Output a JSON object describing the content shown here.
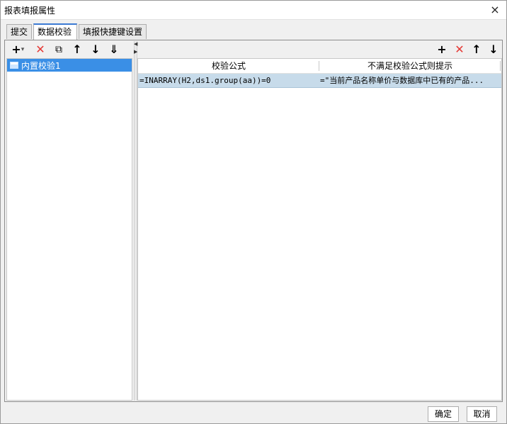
{
  "window": {
    "title": "报表填报属性",
    "close_icon": "×"
  },
  "tabs": [
    {
      "label": "提交",
      "active": false
    },
    {
      "label": "数据校验",
      "active": true
    },
    {
      "label": "填报快捷键设置",
      "active": false
    }
  ],
  "left_toolbar": {
    "add": "+",
    "add_dropdown": "▾",
    "delete": "✕",
    "copy": "⧉",
    "move_up": "↑",
    "move_down": "↓",
    "move_bottom": "⇓"
  },
  "list": {
    "items": [
      {
        "label": "内置校验1",
        "selected": true
      }
    ]
  },
  "right_toolbar": {
    "add": "+",
    "delete": "✕",
    "move_up": "↑",
    "move_down": "↓"
  },
  "table": {
    "columns": [
      "校验公式",
      "不满足校验公式则提示"
    ],
    "rows": [
      {
        "formula": "=INARRAY(H2,ds1.group(aa))=0",
        "message": "=\"当前产品名称单价与数据库中已有的产品..."
      }
    ]
  },
  "footer": {
    "ok": "确定",
    "cancel": "取消"
  },
  "colors": {
    "selection": "#3a8fe6",
    "row_selected": "#c7dbea",
    "delete_red": "#e53935",
    "tab_accent": "#3c7bd4"
  }
}
